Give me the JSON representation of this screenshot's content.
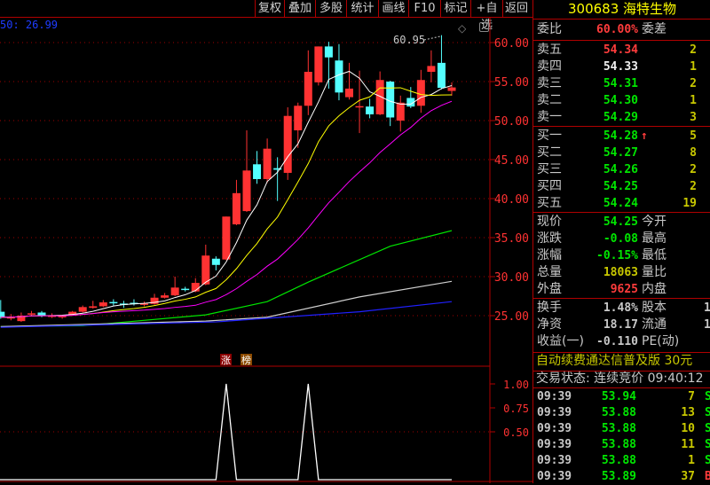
{
  "toolbar": {
    "buttons": [
      "复权",
      "叠加",
      "多股",
      "统计",
      "画线",
      "F10",
      "标记",
      "+自选",
      "返回"
    ]
  },
  "chart": {
    "ma_label": "50: 26.99",
    "max_annotation": "60.95",
    "tags": [
      "涨",
      "榜"
    ]
  },
  "chart_data": [
    {
      "type": "candlestick",
      "y_ticks": [
        "60.00",
        "55.00",
        "50.00",
        "45.00",
        "40.00",
        "35.00",
        "30.00",
        "25.00"
      ],
      "ylim": [
        23,
        62
      ],
      "up_color": "#ff3232",
      "down_color": "#54ffff",
      "candles": [
        [
          25.5,
          27.0,
          24.6,
          24.8
        ],
        [
          24.8,
          25.2,
          24.4,
          24.8
        ],
        [
          24.3,
          25.4,
          24.2,
          25.0
        ],
        [
          25.3,
          25.6,
          24.9,
          25.3
        ],
        [
          25.4,
          25.6,
          24.8,
          25.0
        ],
        [
          25.0,
          25.3,
          24.7,
          25.0
        ],
        [
          24.9,
          25.1,
          24.6,
          24.95
        ],
        [
          25.1,
          25.6,
          25.0,
          25.5
        ],
        [
          25.5,
          26.3,
          25.4,
          26.1
        ],
        [
          26.0,
          26.9,
          25.9,
          26.2
        ],
        [
          26.2,
          27.0,
          26.1,
          26.7
        ],
        [
          26.75,
          27.1,
          26.3,
          26.65
        ],
        [
          26.55,
          26.9,
          26.0,
          26.45
        ],
        [
          26.65,
          27.1,
          26.3,
          26.55
        ],
        [
          26.45,
          26.8,
          26.2,
          26.55
        ],
        [
          26.5,
          27.8,
          26.4,
          27.3
        ],
        [
          27.3,
          27.9,
          27.2,
          27.6
        ],
        [
          27.6,
          30.0,
          27.5,
          28.6
        ],
        [
          28.45,
          28.7,
          28.1,
          28.35
        ],
        [
          28.1,
          29.8,
          28.0,
          29.2
        ],
        [
          29.0,
          34.1,
          28.9,
          32.7
        ],
        [
          32.3,
          32.6,
          30.8,
          31.5
        ],
        [
          32.2,
          37.7,
          32.1,
          37.7
        ],
        [
          36.7,
          42.4,
          36.6,
          40.7
        ],
        [
          38.4,
          48.75,
          38.3,
          43.6
        ],
        [
          44.4,
          46.1,
          41.9,
          42.5
        ],
        [
          42.5,
          47.7,
          42.0,
          46.4
        ],
        [
          43.9,
          45.3,
          39.7,
          43.7
        ],
        [
          43.3,
          51.7,
          42.4,
          50.6
        ],
        [
          48.75,
          52.3,
          46.5,
          51.9
        ],
        [
          51.9,
          59.0,
          50.7,
          56.25
        ],
        [
          54.9,
          59.5,
          54.5,
          59.5
        ],
        [
          59.5,
          60.1,
          54.1,
          58.1
        ],
        [
          57.7,
          59.8,
          52.6,
          53.6
        ],
        [
          53.0,
          57.4,
          52.7,
          54.1
        ],
        [
          51.8,
          56.4,
          48.4,
          51.85
        ],
        [
          51.8,
          52.8,
          50.3,
          50.8
        ],
        [
          50.8,
          56.3,
          50.7,
          55.2
        ],
        [
          55.0,
          55.1,
          49.3,
          50.4
        ],
        [
          50.0,
          53.2,
          48.6,
          52.3
        ],
        [
          52.9,
          54.3,
          51.6,
          51.8
        ],
        [
          51.9,
          56.5,
          51.0,
          55.2
        ],
        [
          56.25,
          59.0,
          54.9,
          57.0
        ],
        [
          57.4,
          60.95,
          54.0,
          54.2
        ],
        [
          53.8,
          54.9,
          53.2,
          54.25
        ]
      ],
      "moving_averages": [
        {
          "period": 5,
          "color": "#ffffff"
        },
        {
          "period": 10,
          "color": "#ffff00"
        },
        {
          "period": 20,
          "color": "#ff00ff"
        }
      ],
      "long_lines": [
        {
          "color": "#00e600",
          "points": [
            [
              0,
              23.6
            ],
            [
              8,
              23.7
            ],
            [
              20,
              25.1
            ],
            [
              26,
              26.8
            ],
            [
              30,
              29.3
            ],
            [
              38,
              33.9
            ],
            [
              44,
              35.9
            ]
          ]
        },
        {
          "color": "#d0d0d0",
          "points": [
            [
              0,
              23.6
            ],
            [
              20,
              24.3
            ],
            [
              26,
              24.8
            ],
            [
              35,
              27.4
            ],
            [
              44,
              29.4
            ]
          ]
        },
        {
          "color": "#2020ff",
          "points": [
            [
              0,
              23.5
            ],
            [
              21,
              24.2
            ],
            [
              35,
              25.5
            ],
            [
              44,
              26.8
            ]
          ]
        }
      ]
    },
    {
      "type": "line",
      "y_ticks": [
        "1.00",
        "0.75",
        "0.50"
      ],
      "ylim": [
        0,
        1
      ],
      "values": [
        0,
        0,
        0,
        0,
        0,
        0,
        0,
        0,
        0,
        0,
        0,
        0,
        0,
        0,
        0,
        0,
        0,
        0,
        0,
        0,
        0,
        0,
        1,
        0,
        0,
        0,
        0,
        0,
        0,
        0,
        1,
        0,
        0,
        0,
        0,
        0,
        0,
        0,
        0,
        0,
        0,
        0,
        0,
        0,
        0
      ]
    }
  ],
  "quote": {
    "title": "300683 海特生物",
    "weibi_label": "委比",
    "weibi_value": "60.00%",
    "weicha_label": "委差",
    "asks": [
      {
        "label": "卖五",
        "price": "54.34",
        "vol": "2",
        "color": "red"
      },
      {
        "label": "卖四",
        "price": "54.33",
        "vol": "1",
        "color": "wht"
      },
      {
        "label": "卖三",
        "price": "54.31",
        "vol": "2",
        "color": "grn"
      },
      {
        "label": "卖二",
        "price": "54.30",
        "vol": "1",
        "color": "grn"
      },
      {
        "label": "卖一",
        "price": "54.29",
        "vol": "3",
        "color": "grn"
      }
    ],
    "bids": [
      {
        "label": "买一",
        "price": "54.28",
        "vol": "5",
        "arrow": "↑"
      },
      {
        "label": "买二",
        "price": "54.27",
        "vol": "8"
      },
      {
        "label": "买三",
        "price": "54.26",
        "vol": "2"
      },
      {
        "label": "买四",
        "price": "54.25",
        "vol": "2"
      },
      {
        "label": "买五",
        "price": "54.24",
        "vol": "19"
      }
    ],
    "stats": [
      {
        "label": "现价",
        "value": "54.25",
        "color": "grn",
        "label2": "今开"
      },
      {
        "label": "涨跌",
        "value": "-0.08",
        "color": "grn",
        "label2": "最高"
      },
      {
        "label": "涨幅",
        "value": "-0.15%",
        "color": "grn",
        "label2": "最低"
      },
      {
        "label": "总量",
        "value": "18063",
        "color": "yel",
        "label2": "量比"
      },
      {
        "label": "外盘",
        "value": "9625",
        "color": "red",
        "label2": "内盘"
      }
    ],
    "stats2": [
      {
        "label": "换手",
        "value": "1.48%",
        "label2": "股本",
        "value2": "1"
      },
      {
        "label": "净资",
        "value": "18.17",
        "label2": "流通",
        "value2": "1"
      },
      {
        "label": "收益(一)",
        "value": "-0.110",
        "label2": "PE(动)",
        "value2": ""
      }
    ],
    "ad": "自动续费通达信普及版 30元",
    "status": "交易状态: 连续竞价 09:40:12",
    "ticks": [
      {
        "time": "09:39",
        "price": "53.94",
        "vol": "7",
        "flag": "S"
      },
      {
        "time": "09:39",
        "price": "53.88",
        "vol": "13",
        "flag": "S"
      },
      {
        "time": "09:39",
        "price": "53.88",
        "vol": "10",
        "flag": "S"
      },
      {
        "time": "09:39",
        "price": "53.88",
        "vol": "11",
        "flag": "S"
      },
      {
        "time": "09:39",
        "price": "53.88",
        "vol": "1",
        "flag": "S"
      },
      {
        "time": "09:39",
        "price": "53.89",
        "vol": "37",
        "flag": "B"
      }
    ]
  }
}
